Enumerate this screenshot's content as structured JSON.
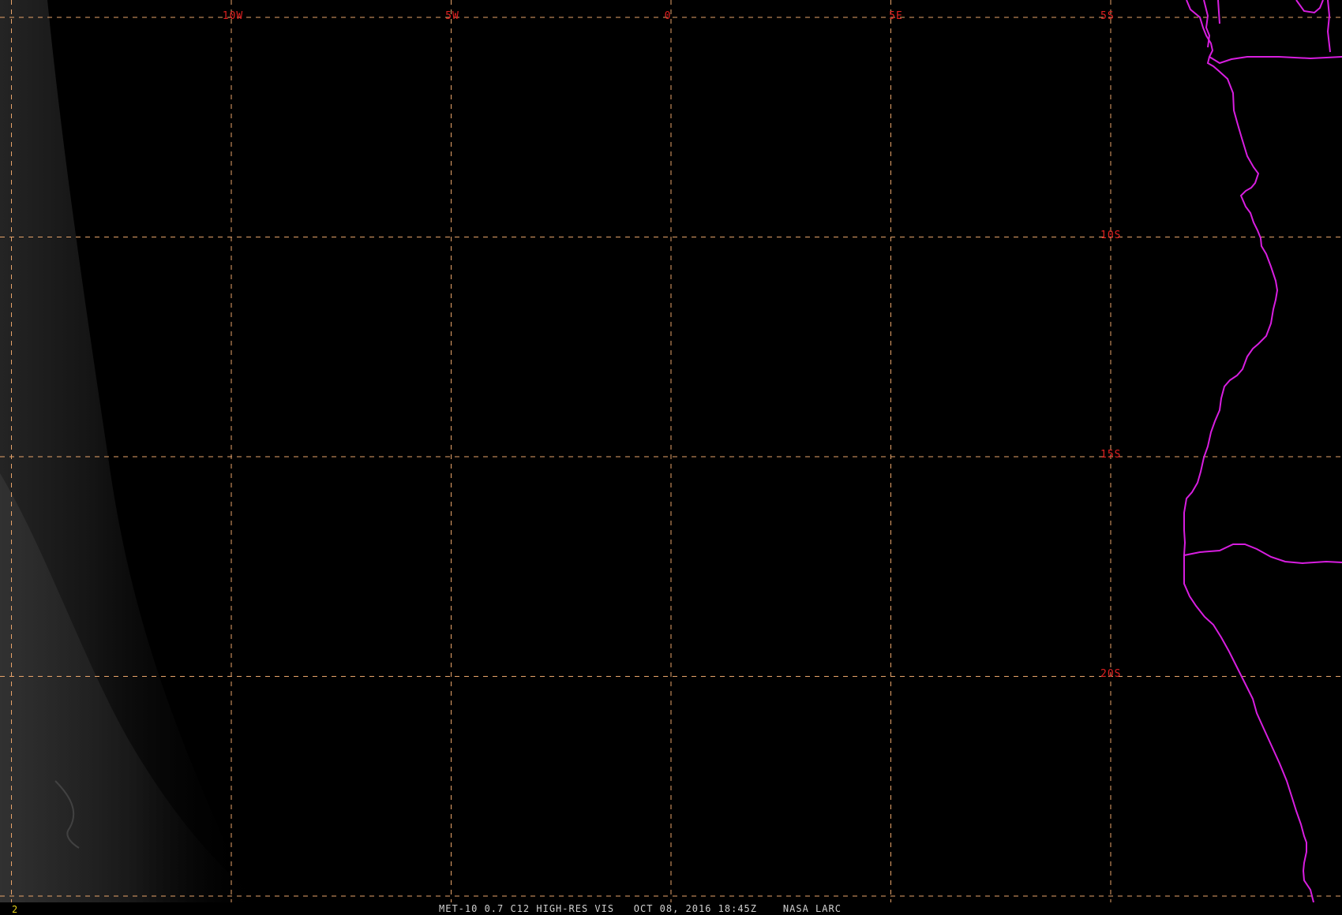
{
  "image": {
    "caption": "MET-10 0.7 C12 HIGH-RES VIS   OCT 08, 2016 18:45Z    NASA LARC",
    "frame_number": "2"
  },
  "grid": {
    "longitudes": [
      {
        "label": "10W",
        "value": -10
      },
      {
        "label": "5W",
        "value": -5
      },
      {
        "label": "0",
        "value": 0
      },
      {
        "label": "5E",
        "value": 5
      }
    ],
    "latitudes": [
      {
        "label": "5S",
        "value": -5
      },
      {
        "label": "10S",
        "value": -10
      },
      {
        "label": "15S",
        "value": -15
      },
      {
        "label": "20S",
        "value": -20
      }
    ]
  },
  "colors": {
    "background": "#000000",
    "gridline": "#e8a46a",
    "grid_label": "#e02020",
    "coastline": "#d81ee0",
    "frame_number": "#e6d21a",
    "caption": "#d0d0d0"
  }
}
